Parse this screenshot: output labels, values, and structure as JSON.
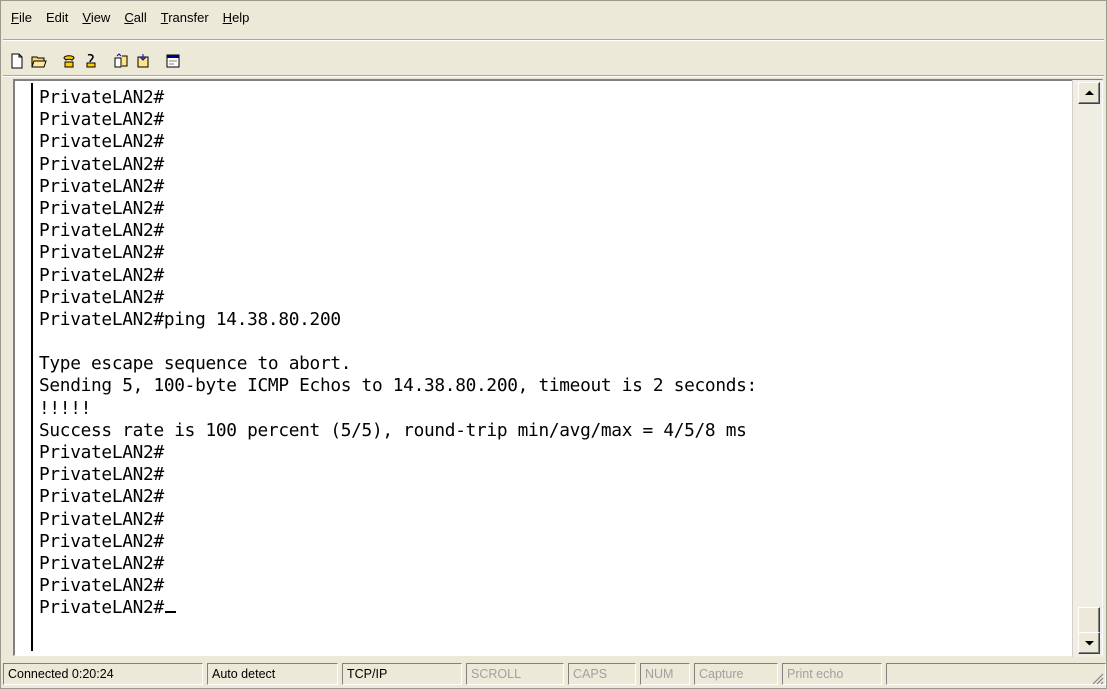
{
  "menu": {
    "items": [
      {
        "accel": "F",
        "rest": "ile"
      },
      {
        "accel": "",
        "rest": "Edit"
      },
      {
        "accel": "V",
        "rest": "iew"
      },
      {
        "accel": "C",
        "rest": "all"
      },
      {
        "accel": "T",
        "rest": "ransfer"
      },
      {
        "accel": "H",
        "rest": "elp"
      }
    ]
  },
  "toolbar": {
    "icons": [
      "new-icon",
      "open-icon",
      "connect-icon",
      "disconnect-icon",
      "send-icon",
      "receive-icon",
      "properties-icon"
    ]
  },
  "terminal": {
    "lines": [
      "PrivateLAN2#",
      "PrivateLAN2#",
      "PrivateLAN2#",
      "PrivateLAN2#",
      "PrivateLAN2#",
      "PrivateLAN2#",
      "PrivateLAN2#",
      "PrivateLAN2#",
      "PrivateLAN2#",
      "PrivateLAN2#",
      "PrivateLAN2#ping 14.38.80.200",
      "",
      "Type escape sequence to abort.",
      "Sending 5, 100-byte ICMP Echos to 14.38.80.200, timeout is 2 seconds:",
      "!!!!!",
      "Success rate is 100 percent (5/5), round-trip min/avg/max = 4/5/8 ms",
      "PrivateLAN2#",
      "PrivateLAN2#",
      "PrivateLAN2#",
      "PrivateLAN2#",
      "PrivateLAN2#",
      "PrivateLAN2#",
      "PrivateLAN2#"
    ],
    "prompt_line": "PrivateLAN2#"
  },
  "status": {
    "connected": "Connected 0:20:24",
    "detect": "Auto detect",
    "protocol": "TCP/IP",
    "scroll": "SCROLL",
    "caps": "CAPS",
    "num": "NUM",
    "capture": "Capture",
    "print_echo": "Print echo"
  }
}
